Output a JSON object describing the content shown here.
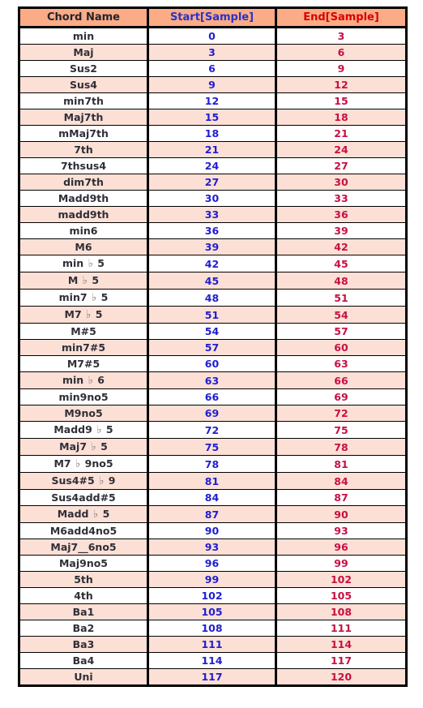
{
  "table": {
    "headers": {
      "name": "Chord Name",
      "start": "Start[Sample]",
      "end": "End[Sample]"
    },
    "colors": {
      "header_background": "#fbab86",
      "row_alt_background": "#fce0d6",
      "row_background": "#ffffff",
      "header_name_text": "#23232b",
      "header_start_text": "#2634c9",
      "header_end_text": "#d90000",
      "cell_name_text": "#2f2f38",
      "cell_start_text": "#1f1fd0",
      "cell_end_text": "#c71042",
      "border": "#000000"
    },
    "rows": [
      {
        "name": "min",
        "start": "0",
        "end": "3"
      },
      {
        "name": "Maj",
        "start": "3",
        "end": "6"
      },
      {
        "name": "Sus2",
        "start": "6",
        "end": "9"
      },
      {
        "name": "Sus4",
        "start": "9",
        "end": "12"
      },
      {
        "name": "min7th",
        "start": "12",
        "end": "15"
      },
      {
        "name": "Maj7th",
        "start": "15",
        "end": "18"
      },
      {
        "name": "mMaj7th",
        "start": "18",
        "end": "21"
      },
      {
        "name": "7th",
        "start": "21",
        "end": "24"
      },
      {
        "name": "7thsus4",
        "start": "24",
        "end": "27"
      },
      {
        "name": "dim7th",
        "start": "27",
        "end": "30"
      },
      {
        "name": "Madd9th",
        "start": "30",
        "end": "33"
      },
      {
        "name": "madd9th",
        "start": "33",
        "end": "36"
      },
      {
        "name": "min6",
        "start": "36",
        "end": "39"
      },
      {
        "name": "M6",
        "start": "39",
        "end": "42"
      },
      {
        "name": "min ♭ 5",
        "start": "42",
        "end": "45"
      },
      {
        "name": "M ♭ 5",
        "start": "45",
        "end": "48"
      },
      {
        "name": "min7 ♭ 5",
        "start": "48",
        "end": "51"
      },
      {
        "name": "M7 ♭ 5",
        "start": "51",
        "end": "54"
      },
      {
        "name": "M#5",
        "start": "54",
        "end": "57"
      },
      {
        "name": "min7#5",
        "start": "57",
        "end": "60"
      },
      {
        "name": "M7#5",
        "start": "60",
        "end": "63"
      },
      {
        "name": "min ♭ 6",
        "start": "63",
        "end": "66"
      },
      {
        "name": "min9no5",
        "start": "66",
        "end": "69"
      },
      {
        "name": "M9no5",
        "start": "69",
        "end": "72"
      },
      {
        "name": "Madd9 ♭ 5",
        "start": "72",
        "end": "75"
      },
      {
        "name": "Maj7 ♭ 5",
        "start": "75",
        "end": "78"
      },
      {
        "name": "M7 ♭ 9no5",
        "start": "78",
        "end": "81"
      },
      {
        "name": "Sus4#5 ♭ 9",
        "start": "81",
        "end": "84"
      },
      {
        "name": "Sus4add#5",
        "start": "84",
        "end": "87"
      },
      {
        "name": "Madd ♭ 5",
        "start": "87",
        "end": "90"
      },
      {
        "name": "M6add4no5",
        "start": "90",
        "end": "93"
      },
      {
        "name": "Maj7__6no5",
        "start": "93",
        "end": "96"
      },
      {
        "name": "Maj9no5",
        "start": "96",
        "end": "99"
      },
      {
        "name": "5th",
        "start": "99",
        "end": "102"
      },
      {
        "name": "4th",
        "start": "102",
        "end": "105"
      },
      {
        "name": "Ba1",
        "start": "105",
        "end": "108"
      },
      {
        "name": "Ba2",
        "start": "108",
        "end": "111"
      },
      {
        "name": "Ba3",
        "start": "111",
        "end": "114"
      },
      {
        "name": "Ba4",
        "start": "114",
        "end": "117"
      },
      {
        "name": "Uni",
        "start": "117",
        "end": "120"
      }
    ]
  }
}
